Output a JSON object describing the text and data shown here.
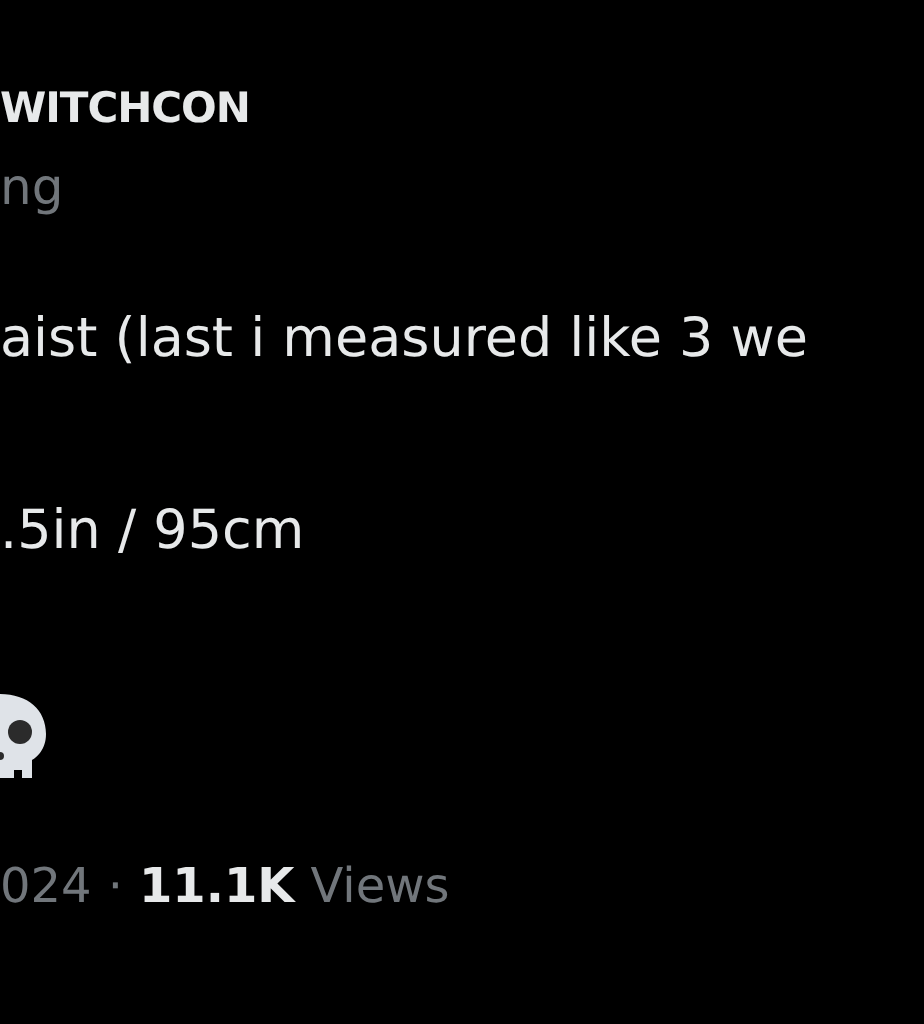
{
  "author": {
    "name": "WITCHCON",
    "handle": "ng"
  },
  "body": {
    "lines": [
      "aist (last i measured like 3 we",
      ".5in / 95cm"
    ]
  },
  "footer": {
    "date": "024",
    "separator": "·",
    "views_count": "11.1K",
    "views_label": "Views"
  }
}
